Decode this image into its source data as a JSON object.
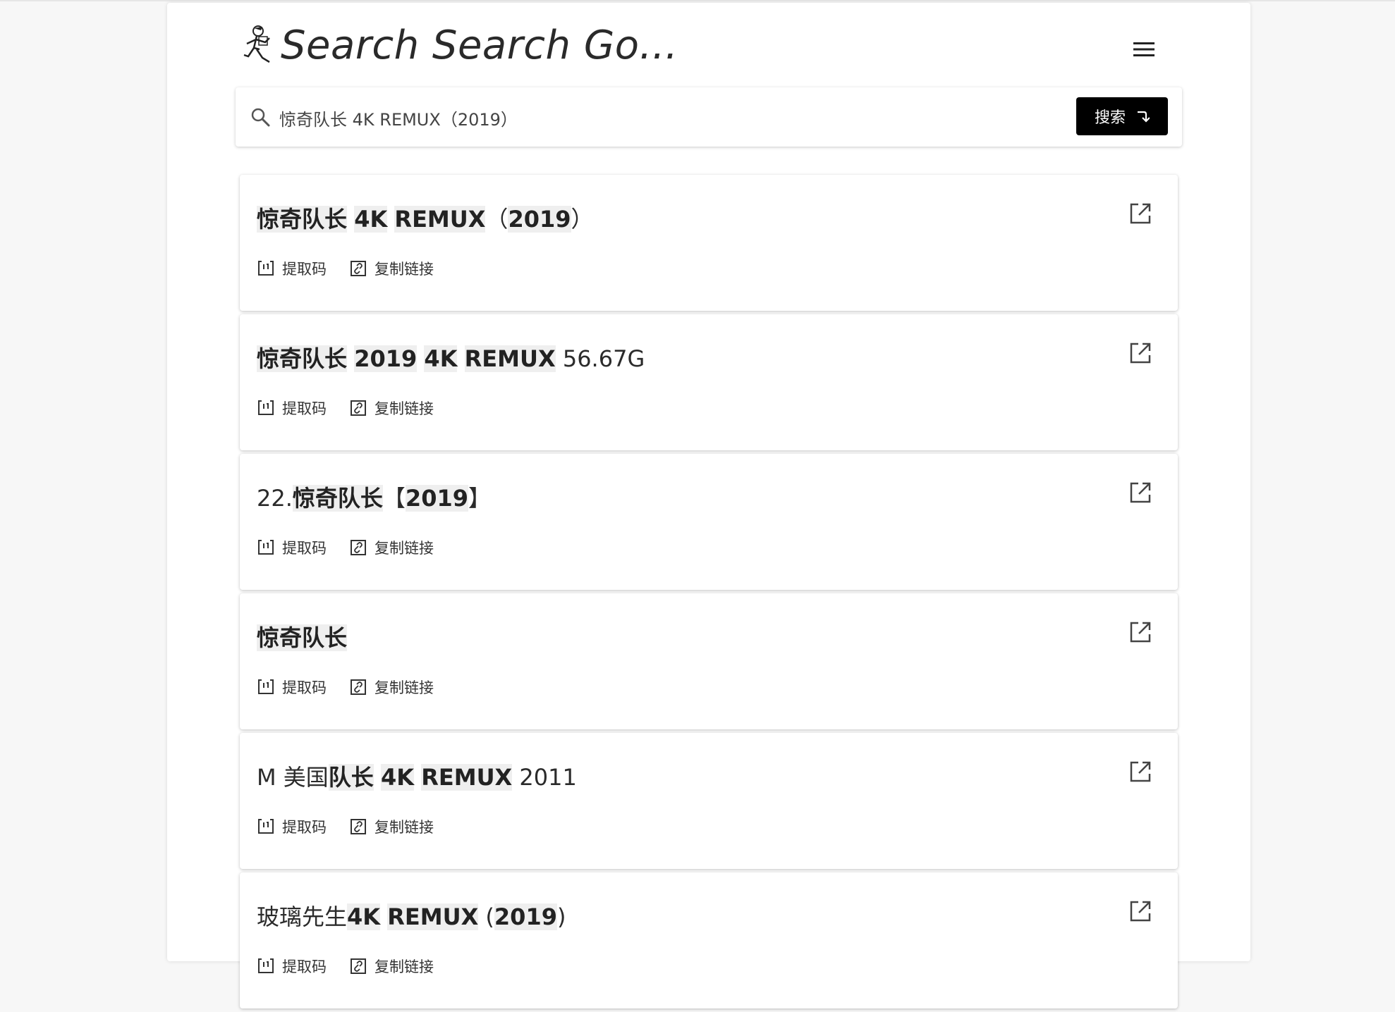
{
  "header": {
    "brand": "Search Search Go...",
    "logo_icon": "running-figure-icon",
    "menu_icon": "hamburger-menu-icon"
  },
  "search": {
    "value": "惊奇队长 4K REMUX（2019）",
    "button_label": "搜索",
    "button_icon": "return-arrow-icon"
  },
  "results": [
    {
      "title_parts": [
        {
          "text": "惊奇队长",
          "hl": true
        },
        {
          "text": " ",
          "hl": false
        },
        {
          "text": "4K",
          "hl": true
        },
        {
          "text": " ",
          "hl": false
        },
        {
          "text": "REMUX",
          "hl": true
        },
        {
          "text": "（",
          "hl": false
        },
        {
          "text": "2019",
          "hl": true
        },
        {
          "text": "）",
          "hl": false
        }
      ],
      "code_label": "提取码",
      "copy_label": "复制链接"
    },
    {
      "title_parts": [
        {
          "text": "惊奇队长",
          "hl": true
        },
        {
          "text": " ",
          "hl": false
        },
        {
          "text": "2019",
          "hl": true
        },
        {
          "text": " ",
          "hl": false
        },
        {
          "text": "4K",
          "hl": true
        },
        {
          "text": " ",
          "hl": false
        },
        {
          "text": "REMUX",
          "hl": true
        },
        {
          "text": " 56.67G",
          "hl": false
        }
      ],
      "code_label": "提取码",
      "copy_label": "复制链接"
    },
    {
      "title_parts": [
        {
          "text": "22.",
          "hl": false
        },
        {
          "text": "惊奇队长",
          "hl": true
        },
        {
          "text": "【",
          "hl": false
        },
        {
          "text": "2019",
          "hl": true
        },
        {
          "text": "】",
          "hl": false
        }
      ],
      "code_label": "提取码",
      "copy_label": "复制链接"
    },
    {
      "title_parts": [
        {
          "text": "惊奇队长",
          "hl": true
        }
      ],
      "code_label": "提取码",
      "copy_label": "复制链接"
    },
    {
      "title_parts": [
        {
          "text": "M 美国",
          "hl": false
        },
        {
          "text": "队长",
          "hl": true
        },
        {
          "text": " ",
          "hl": false
        },
        {
          "text": "4K",
          "hl": true
        },
        {
          "text": " ",
          "hl": false
        },
        {
          "text": "REMUX",
          "hl": true
        },
        {
          "text": " 2011",
          "hl": false
        }
      ],
      "code_label": "提取码",
      "copy_label": "复制链接"
    },
    {
      "title_parts": [
        {
          "text": "玻璃先生",
          "hl": false
        },
        {
          "text": "4K",
          "hl": true
        },
        {
          "text": " ",
          "hl": false
        },
        {
          "text": "REMUX",
          "hl": true
        },
        {
          "text": " (",
          "hl": false
        },
        {
          "text": "2019",
          "hl": true
        },
        {
          "text": ")",
          "hl": false
        }
      ],
      "code_label": "提取码",
      "copy_label": "复制链接"
    }
  ]
}
